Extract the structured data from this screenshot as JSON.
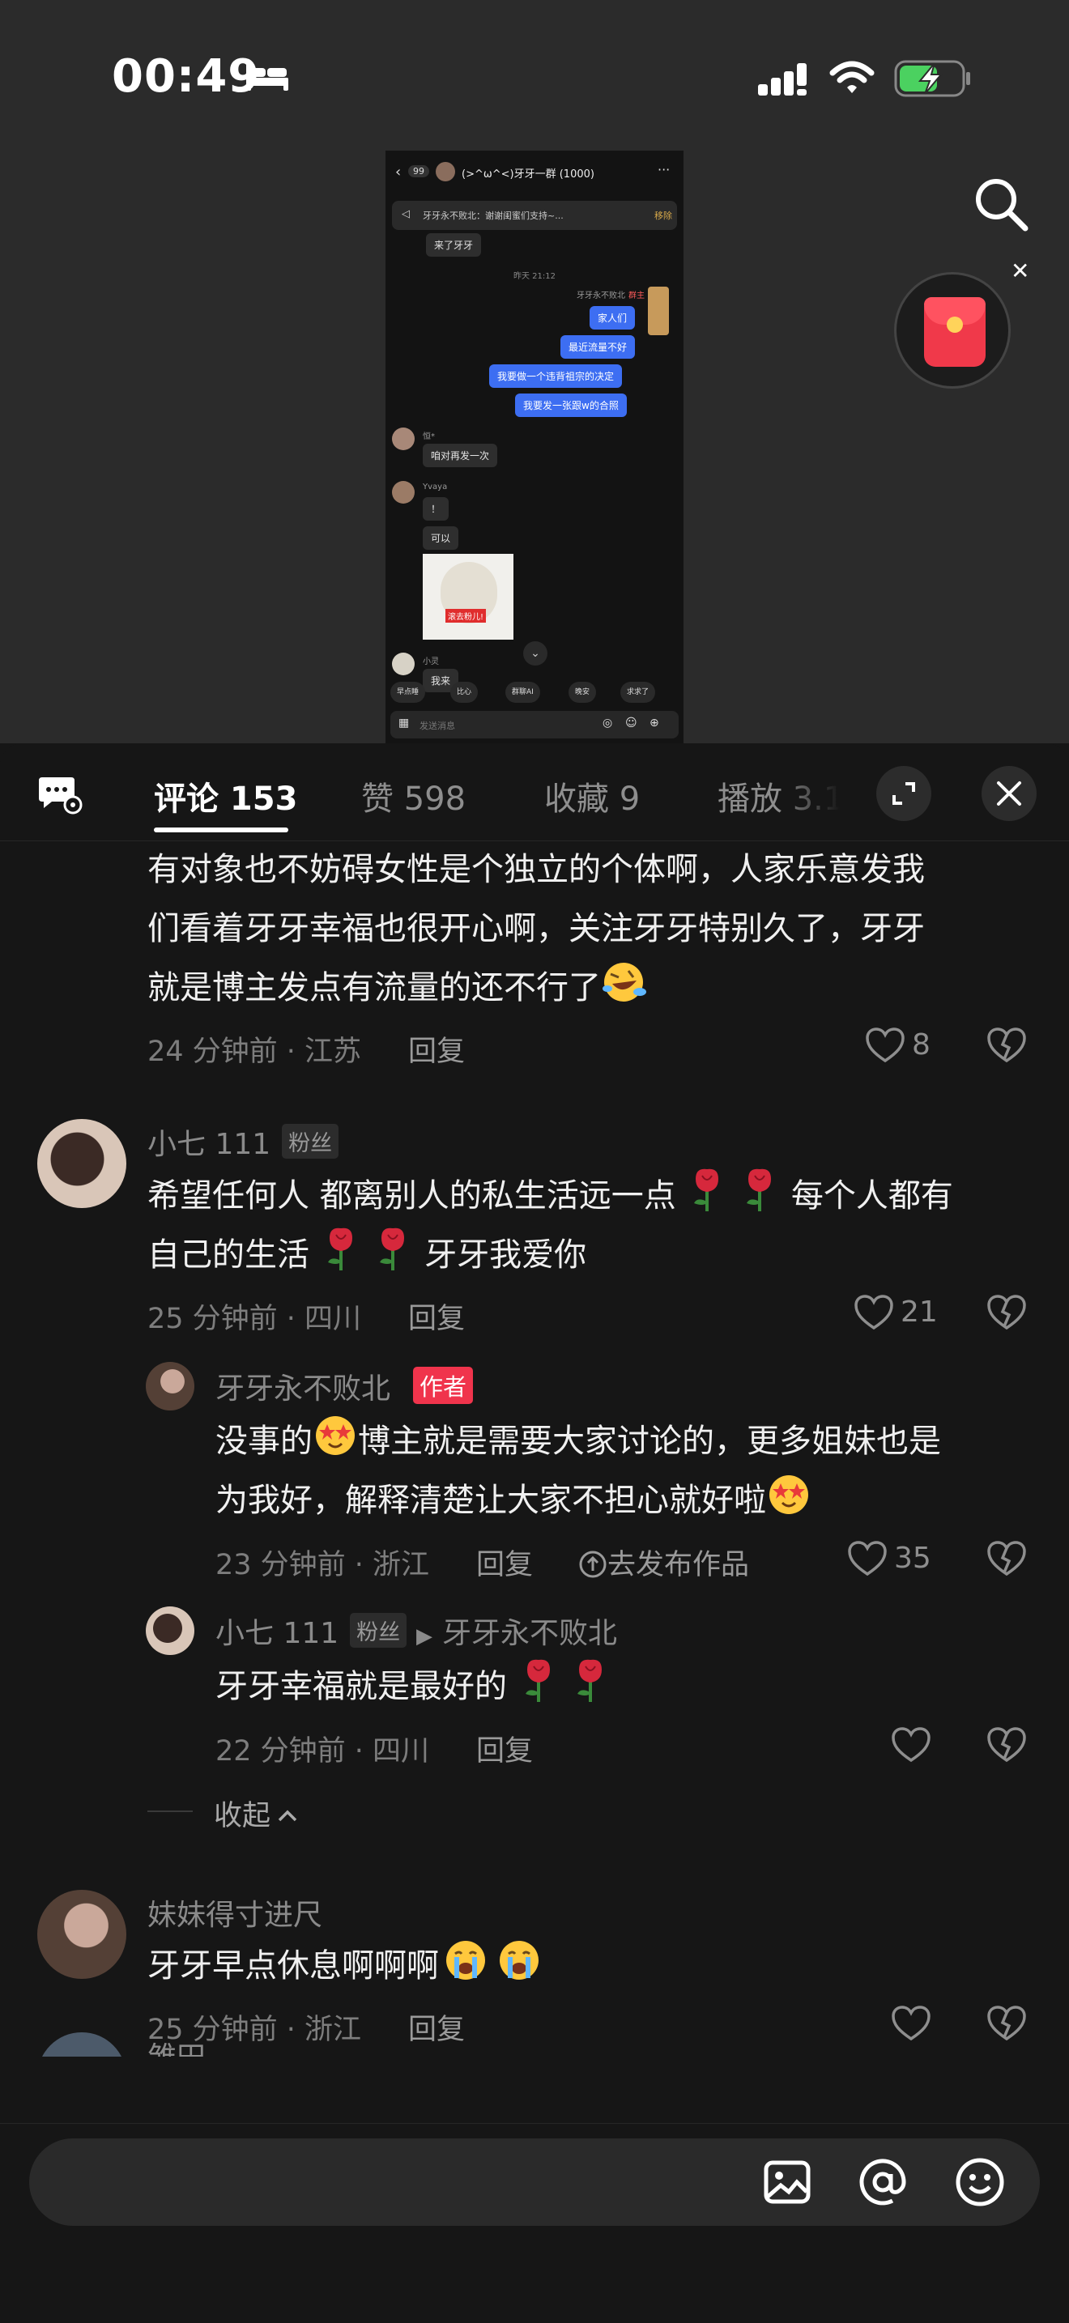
{
  "status_bar": {
    "time": "00:49"
  },
  "preview": {
    "badge": "99",
    "title": "(>^ω^<)牙牙一群 (1000)",
    "notice": "牙牙永不败北：谢谢闺蜜们支持~...",
    "notice_action": "移除",
    "msg_top": "来了牙牙",
    "time_label": "昨天 21:12",
    "sender": "牙牙永不败北",
    "sender_tag": "群主",
    "blue_msgs": [
      "家人们",
      "最近流量不好",
      "我要做一个违背祖宗的决定",
      "我要发一张跟w的合照"
    ],
    "user1": "恒*",
    "user1_msg": "咱对再发一次",
    "user2": "Yvaya",
    "user2_msg1": "！",
    "user2_msg2": "可以",
    "sticker_label": "滚去粉儿!",
    "user3": "小灵",
    "user3_msg": "我来",
    "quick_actions": [
      "早点睡",
      "比心",
      "群聊AI",
      "晚安",
      "求求了"
    ],
    "input_placeholder": "发送消息"
  },
  "tabs": [
    {
      "label": "评论 153"
    },
    {
      "label": "赞 598"
    },
    {
      "label": "收藏 9"
    },
    {
      "label": "播放 3.1"
    }
  ],
  "comments": {
    "c0": {
      "text_line1": "有对象也不妨碍女性是个独立的个体啊，人家乐意发我",
      "text_line2": "们看着牙牙幸福也很开心啊，关注牙牙特别久了，牙牙",
      "text_line3": "就是博主发点有流量的还不行了",
      "meta": "24 分钟前 · 江苏",
      "reply": "回复",
      "likes": "8"
    },
    "c1": {
      "name": "小七 111",
      "badge": "粉丝",
      "text_line1a": "希望任何人 都离别人的私生活远一点",
      "text_line1b": "每个人都有",
      "text_line2a": "自己的生活",
      "text_line2b": "牙牙我爱你",
      "meta": "25 分钟前 · 四川",
      "reply": "回复",
      "likes": "21"
    },
    "r1": {
      "name": "牙牙永不败北",
      "badge": "作者",
      "text_line1a": "没事的",
      "text_line1b": "博主就是需要大家讨论的，更多姐妹也是",
      "text_line2": "为我好，解释清楚让大家不担心就好啦",
      "meta": "23 分钟前 · 浙江",
      "reply": "回复",
      "publish": "去发布作品",
      "likes": "35"
    },
    "r2": {
      "name": "小七 111",
      "badge": "粉丝",
      "reply_to": "牙牙永不败北",
      "text": "牙牙幸福就是最好的",
      "meta": "22 分钟前 · 四川",
      "reply": "回复"
    },
    "collapse": "收起",
    "c2": {
      "name": "妹妹得寸进尺",
      "text": "牙牙早点休息啊啊啊",
      "meta": "25 分钟前 · 浙江",
      "reply": "回复"
    },
    "c3": {
      "name": "雏田"
    }
  },
  "colors": {
    "author_badge": "#f0344c",
    "rose": "#d6283c",
    "panel_bg": "#161616"
  }
}
